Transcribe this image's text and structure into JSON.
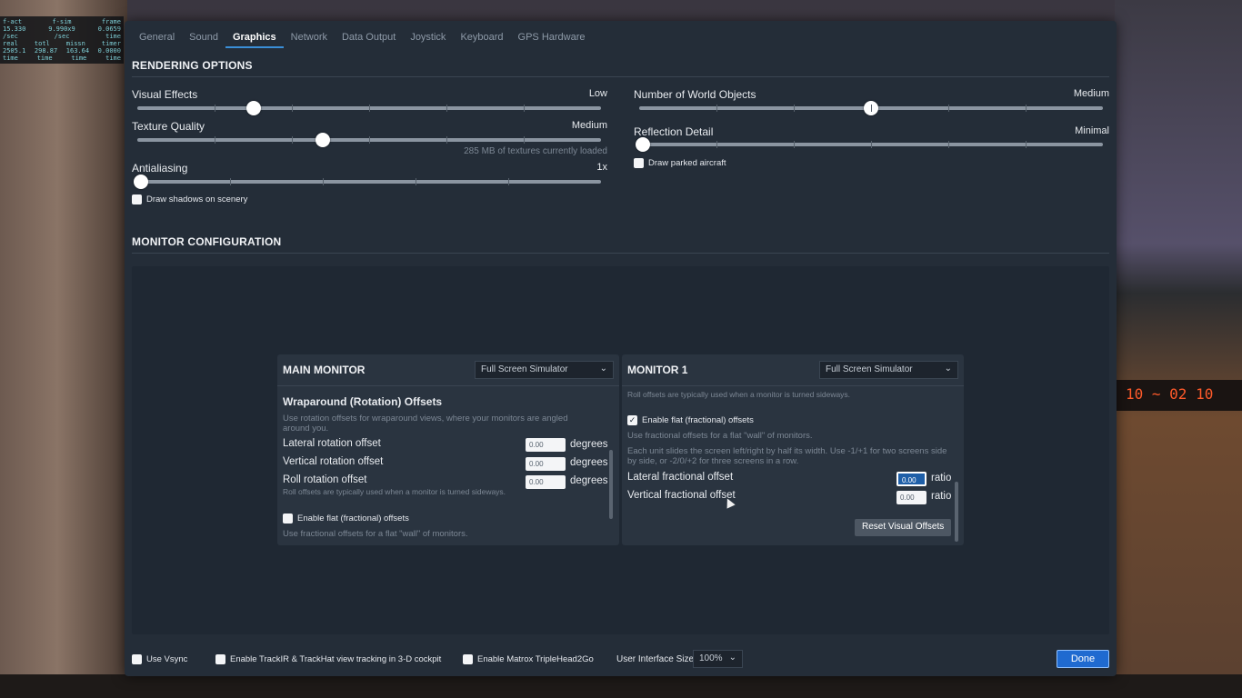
{
  "debug": {
    "rows": [
      [
        "f-act",
        "f-sim",
        "frame"
      ],
      [
        "15.330",
        "9.990x9",
        "0.0659"
      ],
      [
        "/sec",
        "/sec",
        "time"
      ],
      [
        "real",
        "totl",
        "missn",
        "timer"
      ],
      [
        "2505.1",
        "298.87",
        "163.64",
        "0.0000"
      ],
      [
        "time",
        "time",
        "time",
        "time"
      ]
    ]
  },
  "gauge_text": "10 ~ 02 10",
  "tabs": [
    "General",
    "Sound",
    "Graphics",
    "Network",
    "Data Output",
    "Joystick",
    "Keyboard",
    "GPS Hardware"
  ],
  "active_tab": "Graphics",
  "rendering": {
    "title": "RENDERING OPTIONS",
    "visual_effects": {
      "label": "Visual Effects",
      "value": "Low",
      "level": 0.25
    },
    "texture_quality": {
      "label": "Texture Quality",
      "value": "Medium",
      "level": 0.4,
      "note": "285 MB of textures currently loaded"
    },
    "antialiasing": {
      "label": "Antialiasing",
      "value": "1x",
      "level": 0.0
    },
    "draw_shadows": {
      "label": "Draw shadows on scenery",
      "checked": false
    },
    "world_objects": {
      "label": "Number of World Objects",
      "value": "Medium",
      "level": 0.5
    },
    "reflection_detail": {
      "label": "Reflection Detail",
      "value": "Minimal",
      "level": 0.0
    },
    "draw_parked": {
      "label": "Draw parked aircraft",
      "checked": false
    }
  },
  "monitor": {
    "title": "MONITOR CONFIGURATION",
    "main": {
      "title": "MAIN MONITOR",
      "mode": "Full Screen Simulator",
      "wrap_title": "Wraparound (Rotation) Offsets",
      "wrap_desc": "Use rotation offsets for wraparound views, where your monitors are angled around you.",
      "lateral_label": "Lateral rotation offset",
      "lateral_value": "0.00",
      "vertical_label": "Vertical rotation offset",
      "vertical_value": "0.00",
      "roll_label": "Roll rotation offset",
      "roll_value": "0.00",
      "unit": "degrees",
      "roll_desc": "Roll offsets are typically used when a monitor is turned sideways.",
      "flat_label": "Enable flat (fractional) offsets",
      "flat_checked": false,
      "flat_desc": "Use fractional offsets for a flat \"wall\" of monitors."
    },
    "m1": {
      "title": "MONITOR 1",
      "mode": "Full Screen Simulator",
      "roll_desc": "Roll offsets are typically used when a monitor is turned sideways.",
      "flat_label": "Enable flat (fractional) offsets",
      "flat_checked": true,
      "flat_desc": "Use fractional offsets for a flat \"wall\" of monitors.",
      "unit_desc": "Each unit slides the screen left/right by half its width. Use -1/+1 for two screens side by side, or -2/0/+2 for three screens in a row.",
      "lateral_label": "Lateral fractional offset",
      "lateral_value": "0.00",
      "vertical_label": "Vertical fractional offset",
      "vertical_value": "0.00",
      "unit": "ratio",
      "reset_label": "Reset Visual Offsets"
    }
  },
  "bottom": {
    "vsync": {
      "label": "Use Vsync",
      "checked": false
    },
    "trackir": {
      "label": "Enable TrackIR & TrackHat view tracking in 3-D cockpit",
      "checked": false
    },
    "matrox": {
      "label": "Enable Matrox TripleHead2Go",
      "checked": false
    },
    "ui_size_label": "User Interface Size",
    "ui_size_value": "100%",
    "done_label": "Done"
  },
  "colors": {
    "accent": "#1f6ad0",
    "panel": "#242d38",
    "tab_underline": "#3a8fd8"
  }
}
